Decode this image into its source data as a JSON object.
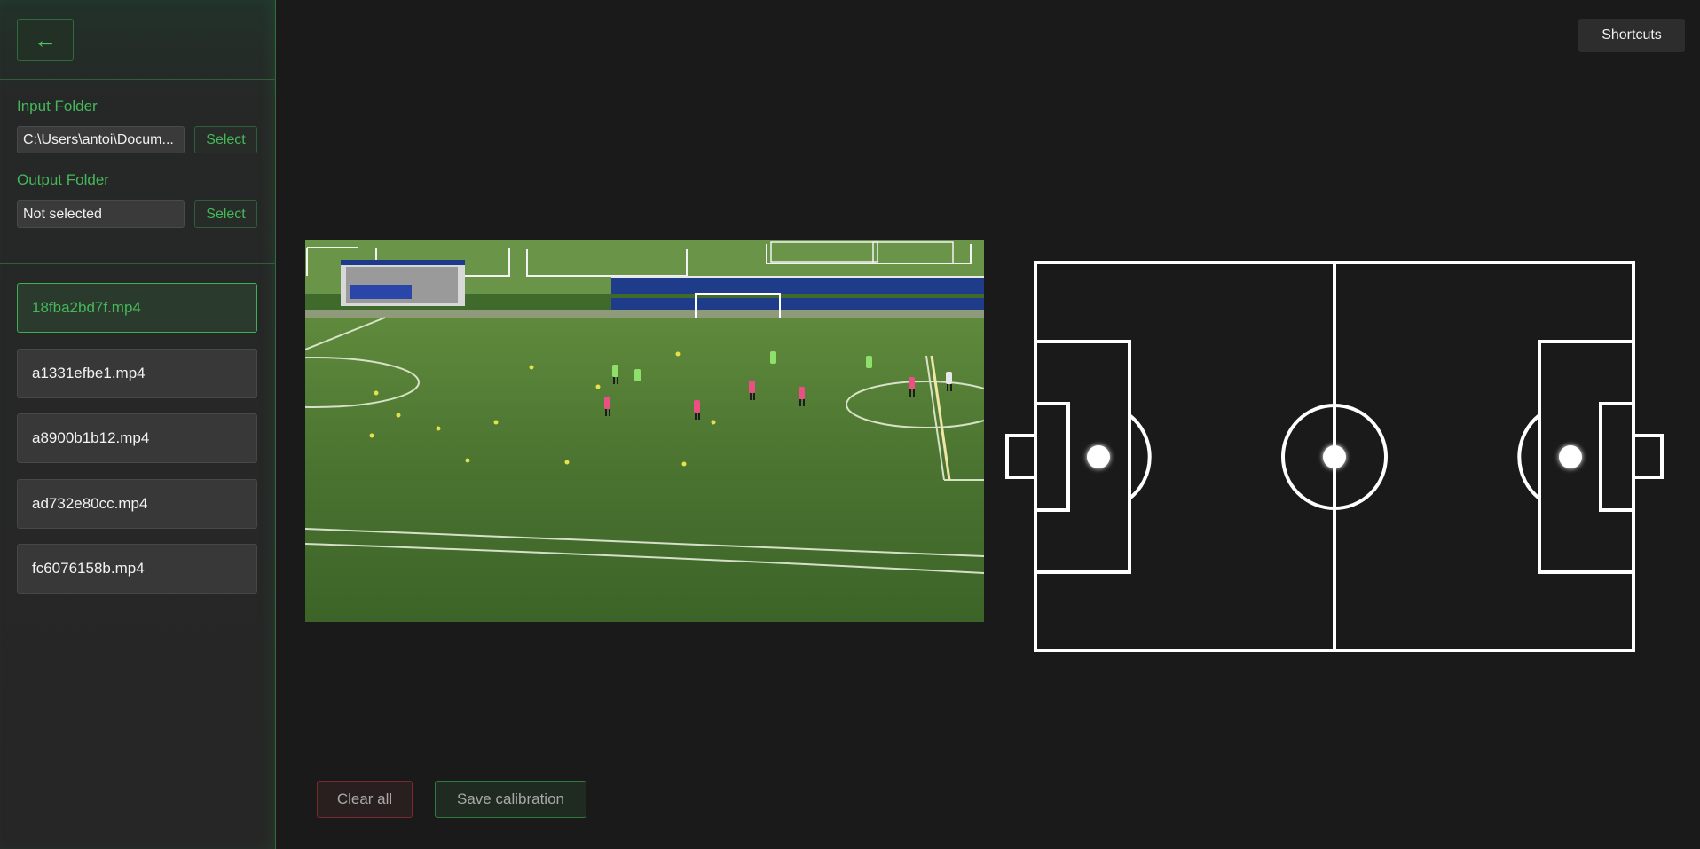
{
  "sidebar": {
    "back_label": "←",
    "input_folder": {
      "label": "Input Folder",
      "value": "C:\\Users\\antoi\\Docum...",
      "select_label": "Select"
    },
    "output_folder": {
      "label": "Output Folder",
      "value": "Not selected",
      "select_label": "Select"
    },
    "files": [
      {
        "name": "18fba2bd7f.mp4",
        "active": true
      },
      {
        "name": "a1331efbe1.mp4",
        "active": false
      },
      {
        "name": "a8900b1b12.mp4",
        "active": false
      },
      {
        "name": "ad732e80cc.mp4",
        "active": false
      },
      {
        "name": "fc6076158b.mp4",
        "active": false
      }
    ]
  },
  "header": {
    "shortcuts_label": "Shortcuts"
  },
  "actions": {
    "clear_label": "Clear all",
    "save_label": "Save calibration"
  },
  "colors": {
    "accent_green": "#45b85a",
    "danger_red": "#7a2a2a",
    "background": "#1a1a1a",
    "pitch_lines": "#ffffff"
  }
}
